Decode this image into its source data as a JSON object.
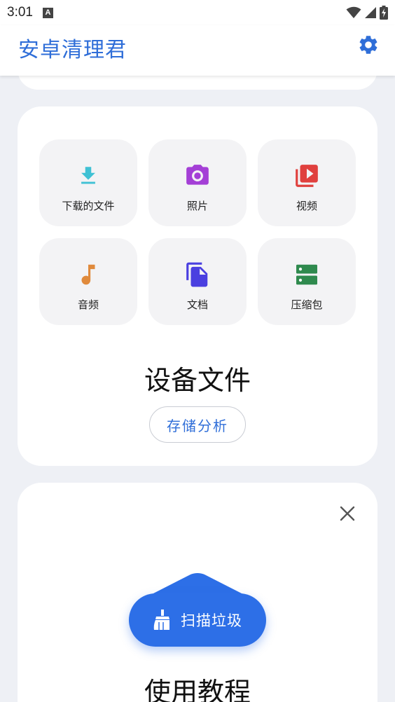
{
  "status_bar": {
    "time": "3:01",
    "notification_glyph": "A"
  },
  "app_bar": {
    "title": "安卓清理君",
    "accent_color": "#2f6ed8"
  },
  "files_card": {
    "tiles": [
      {
        "label": "下载的文件",
        "icon": "download-icon",
        "color": "#3fc1d4"
      },
      {
        "label": "照片",
        "icon": "camera-icon",
        "color": "#a43fd6"
      },
      {
        "label": "视频",
        "icon": "video-library-icon",
        "color": "#e0403e"
      },
      {
        "label": "音频",
        "icon": "music-note-icon",
        "color": "#e08a3c"
      },
      {
        "label": "文档",
        "icon": "document-icon",
        "color": "#4a3fe0"
      },
      {
        "label": "压缩包",
        "icon": "archive-icon",
        "color": "#2f8a4e"
      }
    ],
    "title": "设备文件",
    "storage_button": "存储分析"
  },
  "tutorial_card": {
    "scan_button": "扫描垃圾",
    "title": "使用教程",
    "scan_color": "#2d6fe7"
  }
}
